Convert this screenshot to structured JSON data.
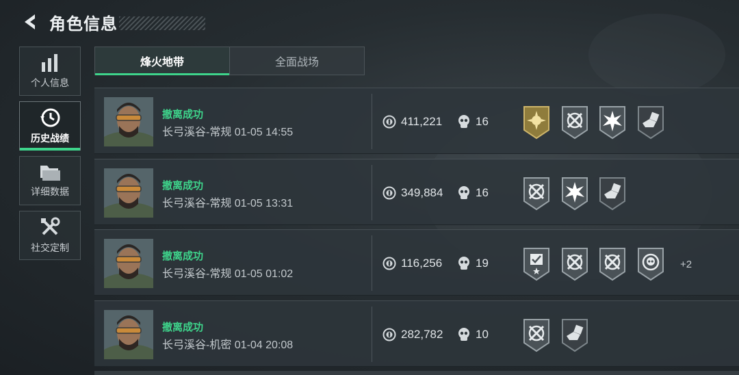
{
  "header": {
    "title": "角色信息",
    "back_icon": "back-arrow-icon"
  },
  "sidebar": {
    "items": [
      {
        "label": "个人信息",
        "icon": "bar-chart-icon",
        "active": false
      },
      {
        "label": "历史战绩",
        "icon": "history-clock-icon",
        "active": true
      },
      {
        "label": "详细数据",
        "icon": "folder-icon",
        "active": false
      },
      {
        "label": "社交定制",
        "icon": "tools-icon",
        "active": false
      }
    ]
  },
  "tabs": [
    {
      "label": "烽火地带",
      "active": true
    },
    {
      "label": "全面战场",
      "active": false
    }
  ],
  "colors": {
    "accent": "#3ed48b",
    "gold_badge": "#b8a15a"
  },
  "matches": [
    {
      "status": "撤离成功",
      "map_time": "长弓溪谷-常规 01-05 14:55",
      "value": "411,221",
      "kills": "16",
      "badges": [
        "gold-sun-badge-icon",
        "crossed-target-badge-icon",
        "burst-badge-icon",
        "hand-dice-badge-icon"
      ],
      "more": ""
    },
    {
      "status": "撤离成功",
      "map_time": "长弓溪谷-常规 01-05 13:31",
      "value": "349,884",
      "kills": "16",
      "badges": [
        "crossed-target-badge-icon",
        "burst-badge-icon",
        "hand-dice-badge-icon"
      ],
      "more": ""
    },
    {
      "status": "撤离成功",
      "map_time": "长弓溪谷-常规 01-05 01:02",
      "value": "116,256",
      "kills": "19",
      "badges": [
        "shield-star-badge-icon",
        "crossed-target-badge-icon",
        "crossed-target-badge-icon",
        "skull-target-badge-icon"
      ],
      "more": "+2"
    },
    {
      "status": "撤离成功",
      "map_time": "长弓溪谷-机密 01-04 20:08",
      "value": "282,782",
      "kills": "10",
      "badges": [
        "crossed-target-badge-icon",
        "hand-dice-badge-icon"
      ],
      "more": ""
    }
  ]
}
